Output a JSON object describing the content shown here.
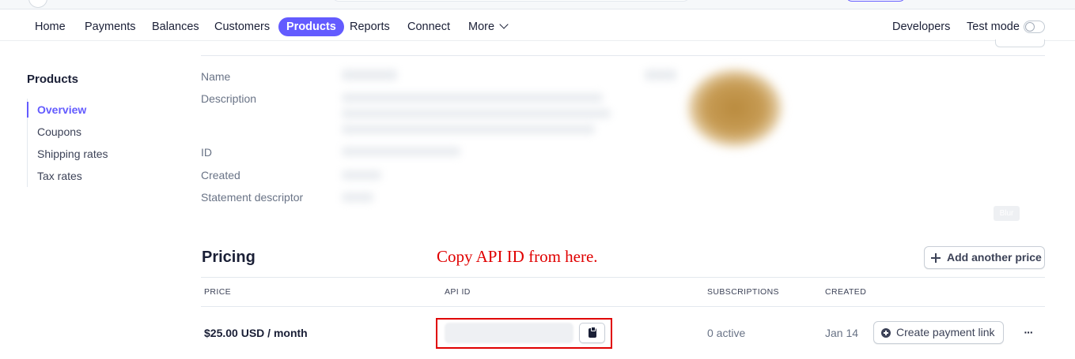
{
  "nav": {
    "items": [
      {
        "label": "Home",
        "active": false
      },
      {
        "label": "Payments",
        "active": false
      },
      {
        "label": "Balances",
        "active": false
      },
      {
        "label": "Customers",
        "active": false
      },
      {
        "label": "Products",
        "active": true
      },
      {
        "label": "Reports",
        "active": false
      },
      {
        "label": "Connect",
        "active": false
      },
      {
        "label": "More",
        "active": false
      }
    ],
    "developers": "Developers",
    "test_mode": "Test mode",
    "test_mode_on": false
  },
  "sidebar": {
    "title": "Products",
    "items": [
      {
        "label": "Overview",
        "active": true
      },
      {
        "label": "Coupons",
        "active": false
      },
      {
        "label": "Shipping rates",
        "active": false
      },
      {
        "label": "Tax rates",
        "active": false
      }
    ]
  },
  "details": {
    "labels": {
      "name": "Name",
      "description": "Description",
      "id": "ID",
      "created": "Created",
      "statement_descriptor": "Statement descriptor"
    },
    "blur_badge": "Blur"
  },
  "pricing": {
    "title": "Pricing",
    "annotation": "Copy API ID from here.",
    "add_price_button": "Add another price",
    "columns": {
      "price": "PRICE",
      "api_id": "API ID",
      "subscriptions": "SUBSCRIPTIONS",
      "created": "CREATED"
    },
    "rows": [
      {
        "price": "$25.00 USD / month",
        "subscriptions": "0 active",
        "created": "Jan 14",
        "payment_link_button": "Create payment link",
        "more": "···"
      }
    ]
  },
  "colors": {
    "accent": "#635bff",
    "annotation_red": "#e00000",
    "text_primary": "#1a1f36",
    "text_secondary": "#697386"
  }
}
